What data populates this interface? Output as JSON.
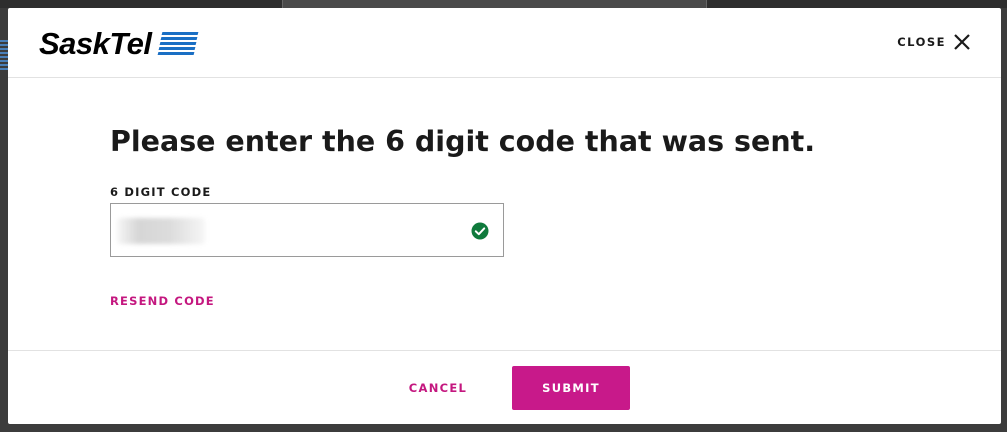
{
  "brand": {
    "name": "SaskTel",
    "logo_color": "#1a6fc4"
  },
  "header": {
    "close_label": "CLOSE",
    "close_icon": "close-icon"
  },
  "main": {
    "title": "Please enter the 6 digit code that was sent.",
    "code_field": {
      "label": "6 DIGIT CODE",
      "value": "",
      "status_icon": "check-circle-icon",
      "status_color": "#0f7a3c"
    },
    "resend_label": "RESEND CODE"
  },
  "footer": {
    "cancel_label": "CANCEL",
    "submit_label": "SUBMIT"
  },
  "colors": {
    "accent": "#c8198a",
    "link": "#c4177f",
    "success": "#0f7a3c"
  }
}
